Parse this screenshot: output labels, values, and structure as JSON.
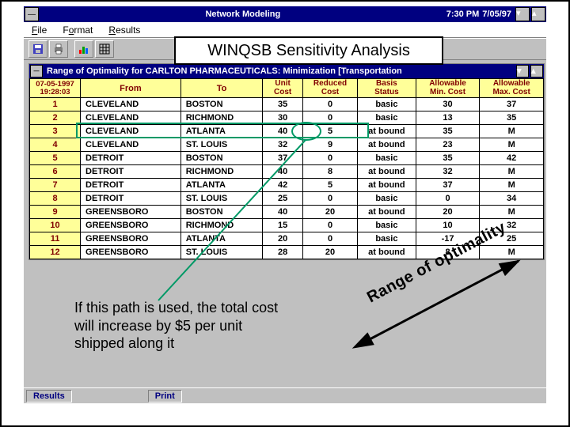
{
  "window": {
    "title": "Network Modeling",
    "time": "7:30 PM",
    "date": "7/05/97"
  },
  "menu": {
    "file": "File",
    "format": "Format",
    "results": "Results"
  },
  "overlay": {
    "label": "WINQSB Sensitivity Analysis"
  },
  "doc": {
    "title": "Range of Optimality for CARLTON PHARMACEUTICALS: Minimization [Transportation"
  },
  "table": {
    "cornerTop": "07-05-1997",
    "cornerBottom": "19:28:03",
    "headers": [
      "From",
      "To",
      "Unit Cost",
      "Reduced Cost",
      "Basis Status",
      "Allowable Min. Cost",
      "Allowable Max. Cost"
    ],
    "rows": [
      {
        "n": "1",
        "from": "CLEVELAND",
        "to": "BOSTON",
        "uc": "35",
        "rc": "0",
        "bs": "basic",
        "amin": "30",
        "amax": "37"
      },
      {
        "n": "2",
        "from": "CLEVELAND",
        "to": "RICHMOND",
        "uc": "30",
        "rc": "0",
        "bs": "basic",
        "amin": "13",
        "amax": "35"
      },
      {
        "n": "3",
        "from": "CLEVELAND",
        "to": "ATLANTA",
        "uc": "40",
        "rc": "5",
        "bs": "at bound",
        "amin": "35",
        "amax": "M"
      },
      {
        "n": "4",
        "from": "CLEVELAND",
        "to": "ST. LOUIS",
        "uc": "32",
        "rc": "9",
        "bs": "at bound",
        "amin": "23",
        "amax": "M"
      },
      {
        "n": "5",
        "from": "DETROIT",
        "to": "BOSTON",
        "uc": "37",
        "rc": "0",
        "bs": "basic",
        "amin": "35",
        "amax": "42"
      },
      {
        "n": "6",
        "from": "DETROIT",
        "to": "RICHMOND",
        "uc": "40",
        "rc": "8",
        "bs": "at bound",
        "amin": "32",
        "amax": "M"
      },
      {
        "n": "7",
        "from": "DETROIT",
        "to": "ATLANTA",
        "uc": "42",
        "rc": "5",
        "bs": "at bound",
        "amin": "37",
        "amax": "M"
      },
      {
        "n": "8",
        "from": "DETROIT",
        "to": "ST. LOUIS",
        "uc": "25",
        "rc": "0",
        "bs": "basic",
        "amin": "0",
        "amax": "34"
      },
      {
        "n": "9",
        "from": "GREENSBORO",
        "to": "BOSTON",
        "uc": "40",
        "rc": "20",
        "bs": "at bound",
        "amin": "20",
        "amax": "M"
      },
      {
        "n": "10",
        "from": "GREENSBORO",
        "to": "RICHMOND",
        "uc": "15",
        "rc": "0",
        "bs": "basic",
        "amin": "10",
        "amax": "32"
      },
      {
        "n": "11",
        "from": "GREENSBORO",
        "to": "ATLANTA",
        "uc": "20",
        "rc": "0",
        "bs": "basic",
        "amin": "-17",
        "amax": "25"
      },
      {
        "n": "12",
        "from": "GREENSBORO",
        "to": "ST. LOUIS",
        "uc": "28",
        "rc": "20",
        "bs": "at bound",
        "amin": "8",
        "amax": "M"
      }
    ]
  },
  "caption": {
    "line1": "If this path is used, the total cost",
    "line2": "will increase by $5 per unit",
    "line3": "shipped along it"
  },
  "diag": "Range of optimality",
  "status": {
    "left": "Results",
    "right": "Print"
  }
}
